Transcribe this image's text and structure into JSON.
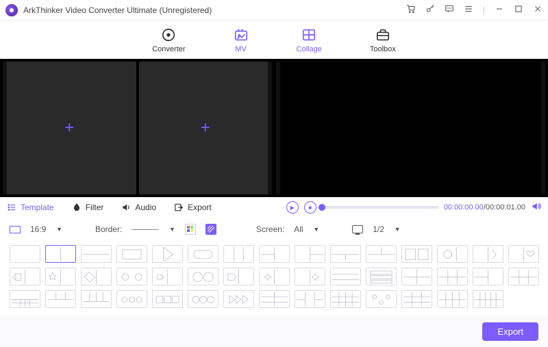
{
  "title": "ArkThinker Video Converter Ultimate (Unregistered)",
  "main_tabs": {
    "converter": "Converter",
    "mv": "MV",
    "collage": "Collage",
    "toolbox": "Toolbox"
  },
  "midbar": {
    "template": "Template",
    "filter": "Filter",
    "audio": "Audio",
    "export": "Export"
  },
  "playback": {
    "current": "00:00:00.00",
    "total": "00:00:01.00",
    "sep": "/"
  },
  "options": {
    "aspect": "16:9",
    "border_label": "Border:",
    "screen_label": "Screen:",
    "screen_value": "All",
    "page": "1/2"
  },
  "footer": {
    "export": "Export"
  }
}
